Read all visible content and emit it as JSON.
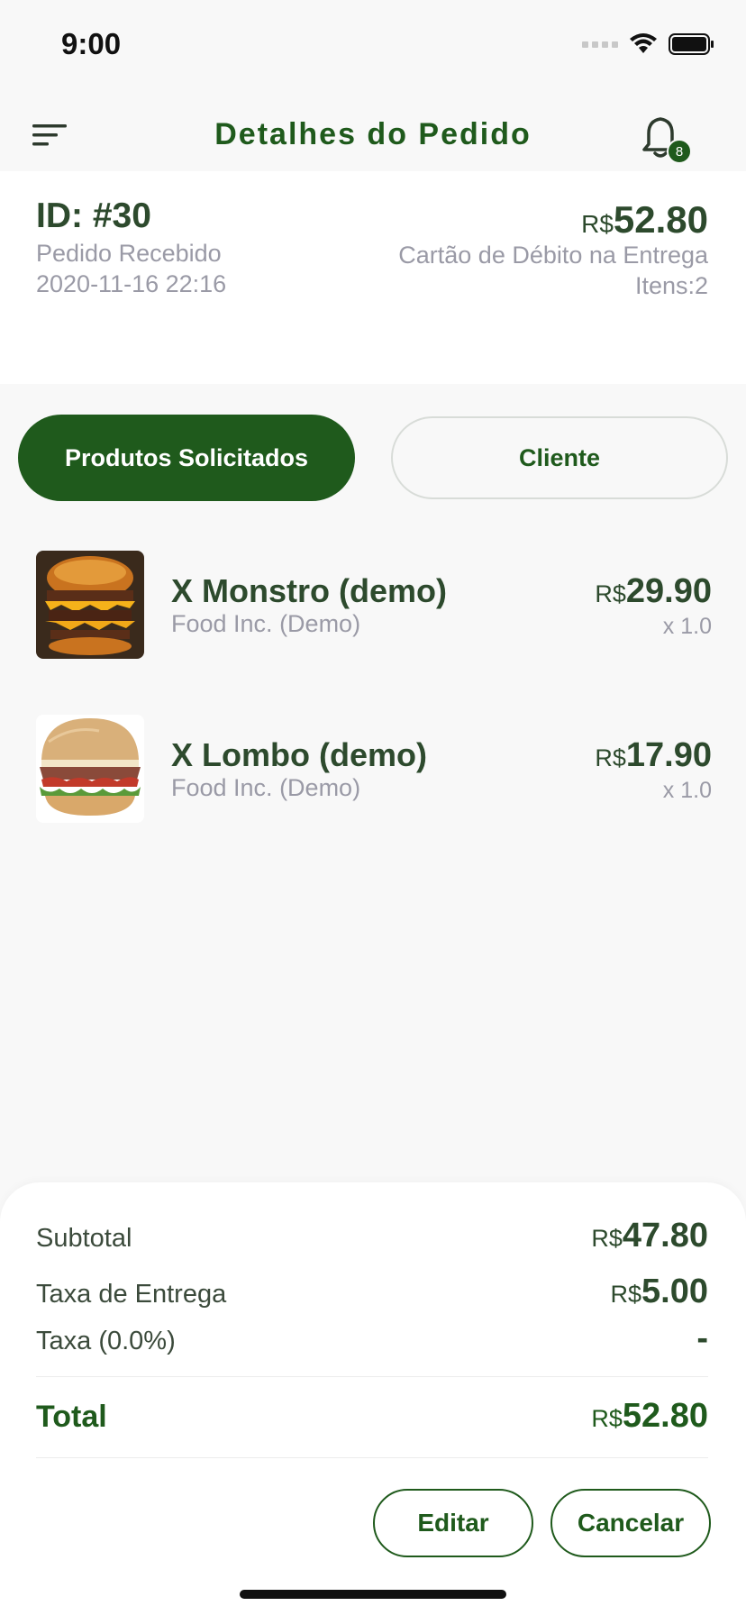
{
  "status_bar": {
    "time": "9:00"
  },
  "header": {
    "title": "Detalhes do Pedido",
    "notification_count": "8"
  },
  "order": {
    "id": "ID: #30",
    "status": "Pedido Recebido",
    "date": "2020-11-16 22:16",
    "currency": "R$",
    "total": "52.80",
    "payment": "Cartão de Débito na Entrega",
    "items": "Itens:2"
  },
  "tabs": [
    {
      "label": "Produtos Solicitados",
      "active": true
    },
    {
      "label": "Cliente",
      "active": false
    }
  ],
  "products": [
    {
      "name": "X Monstro (demo)",
      "store": "Food Inc. (Demo)",
      "currency": "R$",
      "price": "29.90",
      "qty": "x 1.0"
    },
    {
      "name": "X Lombo (demo)",
      "store": "Food Inc. (Demo)",
      "currency": "R$",
      "price": "17.90",
      "qty": "x 1.0"
    }
  ],
  "summary": {
    "subtotal_label": "Subtotal",
    "subtotal_currency": "R$",
    "subtotal_value": "47.80",
    "delivery_label": "Taxa de Entrega",
    "delivery_currency": "R$",
    "delivery_value": "5.00",
    "tax_label": "Taxa (0.0%)",
    "tax_value": "-",
    "total_label": "Total",
    "total_currency": "R$",
    "total_value": "52.80"
  },
  "actions": {
    "edit_label": "Editar",
    "cancel_label": "Cancelar"
  },
  "colors": {
    "primary": "#1f5a1c",
    "text_dark": "#2d4a2d",
    "text_muted": "#9a9aa6",
    "background": "#f8f8f8"
  }
}
